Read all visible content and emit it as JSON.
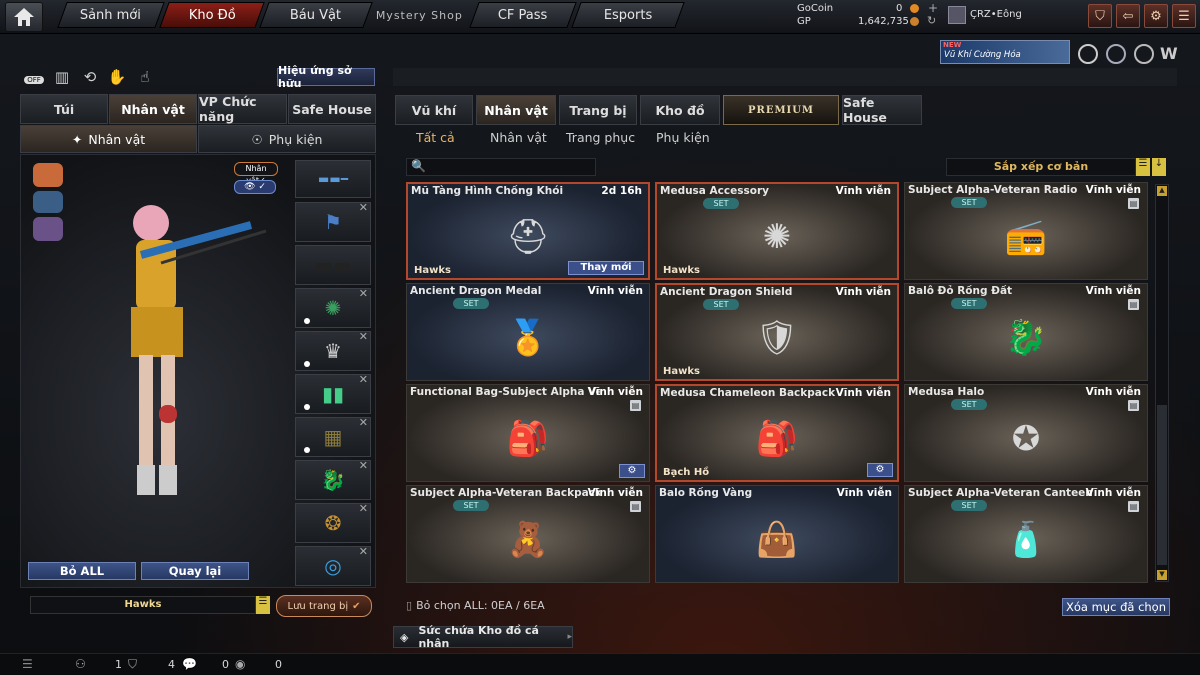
{
  "nav": {
    "tabs": [
      "Sảnh mới",
      "Kho Đồ",
      "Báu Vật",
      "Mystery Shop",
      "CF Pass",
      "Esports"
    ],
    "active": "Kho Đồ"
  },
  "currency": {
    "gocoin_label": "GoCoin",
    "gocoin_value": "0",
    "gp_label": "GP",
    "gp_value": "1,642,735"
  },
  "user": {
    "name": "ÇRZ•Eông"
  },
  "banner": {
    "new": "NEW",
    "text": "Vũ Khí Cường Hóa"
  },
  "left": {
    "effect_button": "Hiệu ứng sở hữu",
    "off_label": "OFF",
    "tabs": [
      "Túi",
      "Nhân vật",
      "VP Chức năng",
      "Safe House"
    ],
    "subtabs": [
      "Nhân vật",
      "Phụ kiện"
    ],
    "badge": "Nhân vật",
    "remove_all": "Bỏ ALL",
    "back": "Quay lại",
    "preset_name": "Hawks",
    "save": "Lưu trang bị"
  },
  "main": {
    "tabs": [
      "Vũ khí",
      "Nhân vật",
      "Trang bị",
      "Kho đồ",
      "PREMIUM",
      "Safe House"
    ],
    "subtabs": [
      "Tất cả",
      "Nhân vật",
      "Trang phục",
      "Phụ kiện"
    ],
    "sort": "Sắp xếp cơ bản",
    "items": [
      {
        "name": "Mũ Tàng Hình Chống Khói",
        "duration": "2d 16h",
        "owner": "Hawks",
        "action": "Thay mới",
        "set": false,
        "icon": "helmet-icon",
        "img": "⛑"
      },
      {
        "name": "Medusa Accessory",
        "duration": "Vĩnh viễn",
        "owner": "Hawks",
        "set": true,
        "set_label": "SET",
        "icon": "emblem-icon",
        "img": "✺"
      },
      {
        "name": "Subject Alpha-Veteran Radio",
        "duration": "Vĩnh viễn",
        "set": true,
        "set_label": "SET",
        "trash": true,
        "icon": "radio-icon",
        "img": "📻"
      },
      {
        "name": "Ancient Dragon Medal",
        "duration": "Vĩnh viễn",
        "set": true,
        "set_label": "SET",
        "icon": "medal-icon",
        "img": "🏅"
      },
      {
        "name": "Ancient Dragon Shield",
        "duration": "Vĩnh viễn",
        "owner": "Hawks",
        "set": true,
        "set_label": "SET",
        "icon": "shield-icon",
        "img": "🛡"
      },
      {
        "name": "Balô Đỏ Rồng Đất",
        "duration": "Vĩnh viễn",
        "set": true,
        "set_label": "SET",
        "trash": true,
        "icon": "dragon-backpack-icon",
        "img": "🐉"
      },
      {
        "name": "Functional Bag-Subject Alpha Veteran",
        "duration": "Vĩnh viễn",
        "trash": true,
        "gear": true,
        "icon": "bag-icon",
        "img": "🎒"
      },
      {
        "name": "Medusa Chameleon Backpack",
        "duration": "Vĩnh viễn",
        "owner": "Bạch Hồ",
        "gear": true,
        "icon": "backpack-icon",
        "img": "🎒"
      },
      {
        "name": "Medusa Halo",
        "duration": "Vĩnh viễn",
        "set": true,
        "set_label": "SET",
        "trash": true,
        "icon": "halo-icon",
        "img": "✪"
      },
      {
        "name": "Subject Alpha-Veteran Backpack",
        "duration": "Vĩnh viễn",
        "set": true,
        "set_label": "SET",
        "trash": true,
        "icon": "doll-icon",
        "img": "🧸"
      },
      {
        "name": "Balo Rồng Vàng",
        "duration": "Vĩnh viễn",
        "icon": "gold-backpack-icon",
        "img": "👜"
      },
      {
        "name": "Subject Alpha-Veteran Canteen",
        "duration": "Vĩnh viễn",
        "set": true,
        "set_label": "SET",
        "trash": true,
        "icon": "canteen-icon",
        "img": "🧴"
      }
    ],
    "selected_text": "Bỏ chọn ALL: 0EA / 6EA",
    "delete_selected": "Xóa mục đã chọn",
    "capacity": "Sức chứa Kho đồ cá nhân"
  },
  "status": {
    "a": "1",
    "b": "4",
    "c": "0",
    "d": "0"
  },
  "colors": {
    "accent": "#b3482c",
    "button": "#3e5487",
    "set": "#2e6f72",
    "active_sub": "#e5b46a"
  }
}
